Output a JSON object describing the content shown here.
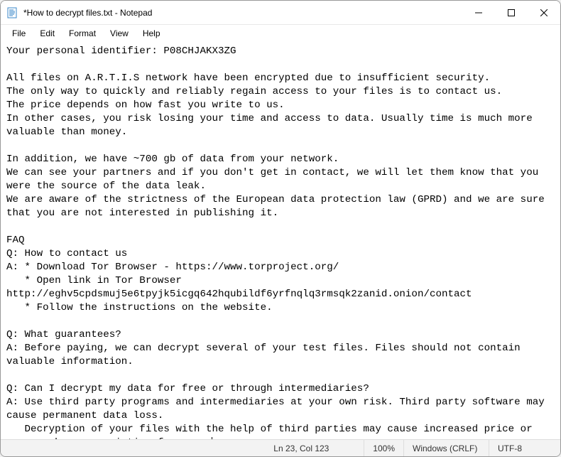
{
  "titlebar": {
    "title": "*How to decrypt files.txt - Notepad",
    "icon": "notepad-icon"
  },
  "window_controls": {
    "minimize": "minimize",
    "maximize": "maximize",
    "close": "close"
  },
  "menu": {
    "file": "File",
    "edit": "Edit",
    "format": "Format",
    "view": "View",
    "help": "Help"
  },
  "document_text": "Your personal identifier: P08CHJAKX3ZG\n\nAll files on A.R.T.I.S network have been encrypted due to insufficient security.\nThe only way to quickly and reliably regain access to your files is to contact us.\nThe price depends on how fast you write to us.\nIn other cases, you risk losing your time and access to data. Usually time is much more valuable than money.\n\nIn addition, we have ~700 gb of data from your network.\nWe can see your partners and if you don't get in contact, we will let them know that you were the source of the data leak.\nWe are aware of the strictness of the European data protection law (GPRD) and we are sure that you are not interested in publishing it.\n\nFAQ\nQ: How to contact us\nA: * Download Tor Browser - https://www.torproject.org/\n   * Open link in Tor Browser http://eghv5cpdsmuj5e6tpyjk5icgq642hqubildf6yrfnqlq3rmsqk2zanid.onion/contact\n   * Follow the instructions on the website.\n\nQ: What guarantees?\nA: Before paying, we can decrypt several of your test files. Files should not contain valuable information.\n\nQ: Can I decrypt my data for free or through intermediaries?\nA: Use third party programs and intermediaries at your own risk. Third party software may cause permanent data loss.\n   Decryption of your files with the help of third parties may cause increased price or you can become a victim of a scam.",
  "status": {
    "position": "Ln 23, Col 123",
    "zoom": "100%",
    "line_ending": "Windows (CRLF)",
    "encoding": "UTF-8"
  }
}
